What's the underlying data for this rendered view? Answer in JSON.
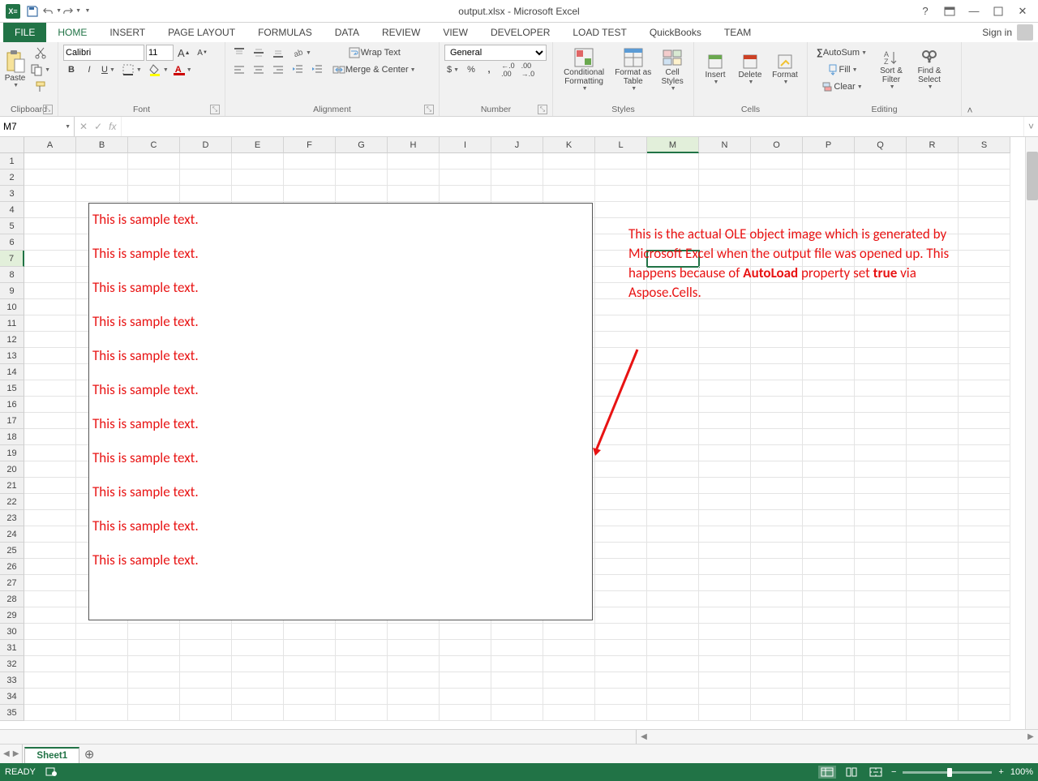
{
  "title": "output.xlsx - Microsoft Excel",
  "signin": "Sign in",
  "tabs": {
    "file": "FILE",
    "home": "HOME",
    "insert": "INSERT",
    "pagelayout": "PAGE LAYOUT",
    "formulas": "FORMULAS",
    "data": "DATA",
    "review": "REVIEW",
    "view": "VIEW",
    "developer": "DEVELOPER",
    "loadtest": "LOAD TEST",
    "quickbooks": "QuickBooks",
    "team": "TEAM"
  },
  "ribbon": {
    "clipboard": {
      "label": "Clipboard",
      "paste": "Paste"
    },
    "font": {
      "label": "Font",
      "name": "Calibri",
      "size": "11"
    },
    "alignment": {
      "label": "Alignment",
      "wrap": "Wrap Text",
      "merge": "Merge & Center"
    },
    "number": {
      "label": "Number",
      "format": "General"
    },
    "styles": {
      "label": "Styles",
      "cond": "Conditional Formatting",
      "table": "Format as Table",
      "cell": "Cell Styles"
    },
    "cells": {
      "label": "Cells",
      "insert": "Insert",
      "delete": "Delete",
      "format": "Format"
    },
    "editing": {
      "label": "Editing",
      "autosum": "AutoSum",
      "fill": "Fill",
      "clear": "Clear",
      "sortfilter": "Sort & Filter",
      "findselect": "Find & Select"
    }
  },
  "namebox": "M7",
  "fx": "fx",
  "cols": [
    "A",
    "B",
    "C",
    "D",
    "E",
    "F",
    "G",
    "H",
    "I",
    "J",
    "K",
    "L",
    "M",
    "N",
    "O",
    "P",
    "Q",
    "R",
    "S"
  ],
  "rows": [
    "1",
    "2",
    "3",
    "4",
    "5",
    "6",
    "7",
    "8",
    "9",
    "10",
    "11",
    "12",
    "13",
    "14",
    "15",
    "16",
    "17",
    "18",
    "19",
    "20",
    "21",
    "22",
    "23",
    "24",
    "25",
    "26",
    "27",
    "28",
    "29",
    "30",
    "31",
    "32",
    "33",
    "34",
    "35"
  ],
  "selected": {
    "col": "M",
    "row": "7"
  },
  "ole_lines": [
    "This is sample text.",
    "This is sample text.",
    "This is sample text.",
    "This is sample text.",
    "This is sample text.",
    "This is sample text.",
    "This is sample text.",
    "This is sample text.",
    "This is sample text.",
    "This is sample text.",
    "This is sample text."
  ],
  "annotation": {
    "p1": "This is the actual OLE object image which is generated by Microsoft Excel when the output file was opened up. This happens because of ",
    "b1": "AutoLoad",
    "p2": " property set ",
    "b2": "true",
    "p3": " via Aspose.Cells."
  },
  "sheet": "Sheet1",
  "status": "READY",
  "zoom": "100%"
}
